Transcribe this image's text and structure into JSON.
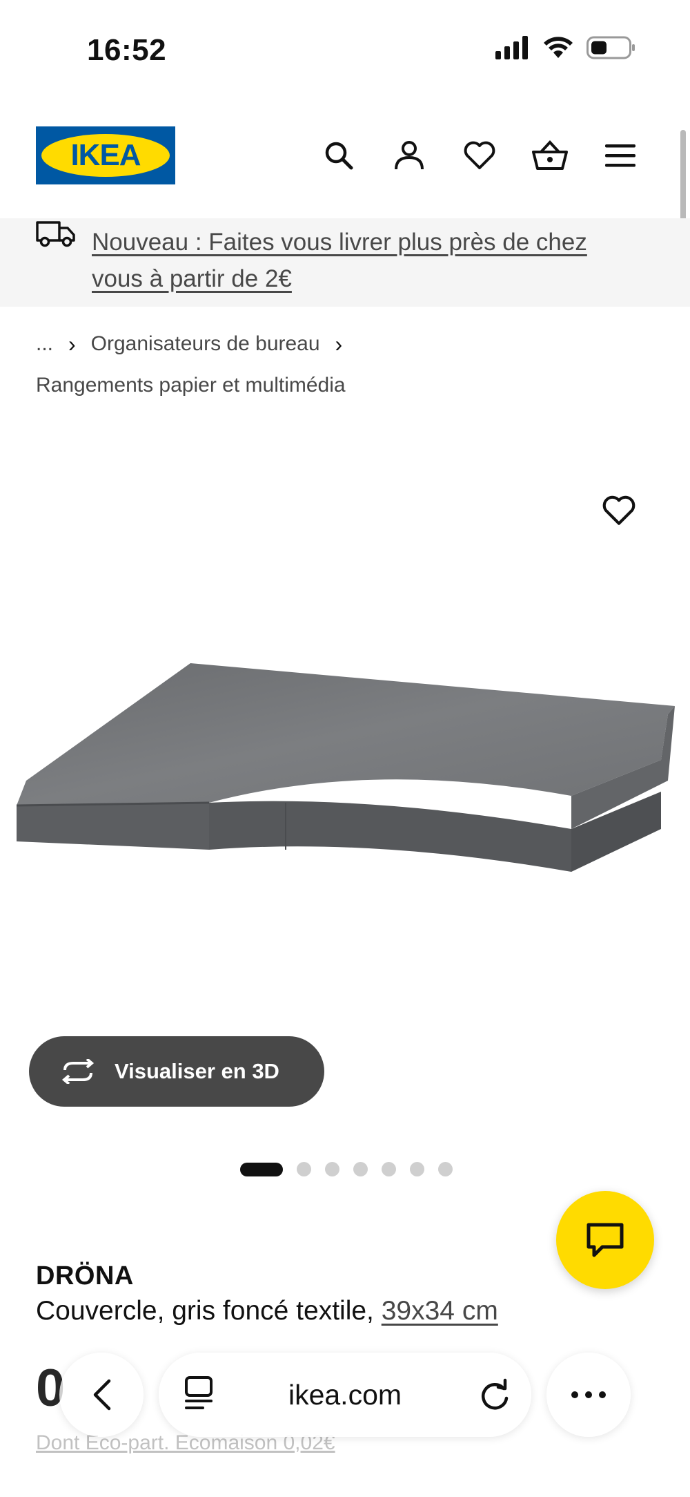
{
  "status_bar": {
    "time": "16:52"
  },
  "header": {
    "logo_text": "IKEA"
  },
  "banner": {
    "text": "Nouveau : Faites vous livrer plus près de chez vous à partir de 2€"
  },
  "breadcrumb": {
    "ellipsis": "...",
    "separator": "›",
    "item1": "Organisateurs de bureau",
    "item2": "Rangements papier et multimédia"
  },
  "gallery": {
    "view_3d_label": "Visualiser en 3D",
    "slide_count": 7,
    "active_slide": 1
  },
  "product": {
    "name": "DRÖNA",
    "description": "Couvercle, gris foncé textile, ",
    "size": "39x34 cm",
    "price_partial": "0",
    "eco_note": "Dont Eco-part. Ecomaison 0,02€"
  },
  "browser": {
    "url": "ikea.com"
  },
  "colors": {
    "brand_blue": "#0058a3",
    "brand_yellow": "#ffdb00",
    "product_gray": "#6b6d70"
  }
}
